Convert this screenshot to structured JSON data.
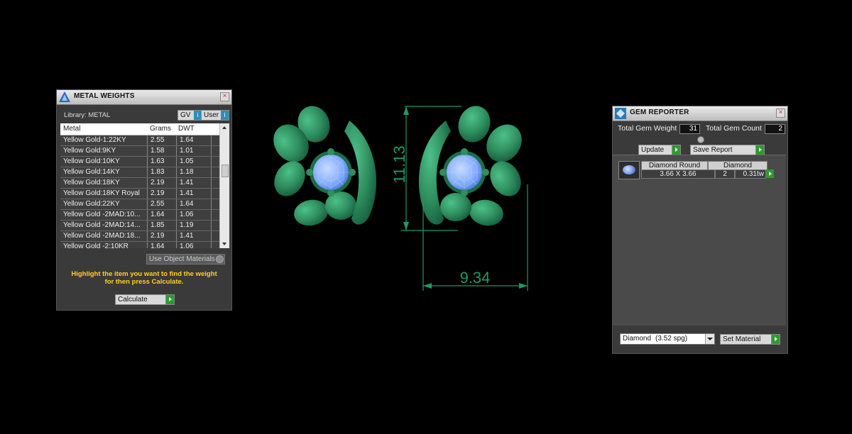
{
  "metal_weights": {
    "title": "METAL WEIGHTS",
    "library_label": "Library: METAL",
    "gv_label": "GV",
    "user_label": "User",
    "columns": [
      "Metal",
      "Grams",
      "DWT"
    ],
    "rows": [
      [
        "Yellow Gold-1:22KY",
        "2.55",
        "1.64"
      ],
      [
        "Yellow Gold:9KY",
        "1.58",
        "1.01"
      ],
      [
        "Yellow Gold:10KY",
        "1.63",
        "1.05"
      ],
      [
        "Yellow Gold:14KY",
        "1.83",
        "1.18"
      ],
      [
        "Yellow Gold:18KY",
        "2.19",
        "1.41"
      ],
      [
        "Yellow Gold:18KY Royal",
        "2.19",
        "1.41"
      ],
      [
        "Yellow Gold:22KY",
        "2.55",
        "1.64"
      ],
      [
        "Yellow Gold -2MAD:10...",
        "1.64",
        "1.06"
      ],
      [
        "Yellow Gold -2MAD:14...",
        "1.85",
        "1.19"
      ],
      [
        "Yellow Gold -2MAD:18...",
        "2.19",
        "1.41"
      ],
      [
        "Yellow Gold -2:10KR",
        "1.64",
        "1.06"
      ]
    ],
    "use_object_materials": "Use Object Materials",
    "hint_line1": "Highlight the item you want to find the weight",
    "hint_line2": "for then press Calculate.",
    "calculate_label": "Calculate"
  },
  "drawing": {
    "height_dim": "11.13",
    "width_dim": "9.34",
    "metal_color": "#2f8f5e",
    "gem_color": "#7fa9ff",
    "dim_color": "#1f9a62"
  },
  "gem_reporter": {
    "title": "GEM REPORTER",
    "total_weight_label": "Total Gem Weight",
    "total_weight_value": "31",
    "total_count_label": "Total Gem Count",
    "total_count_value": "2",
    "update_label": "Update",
    "save_report_label": "Save Report",
    "gem": {
      "shape": "Diamond Round",
      "size": "3.66 X 3.66",
      "material": "Diamond",
      "count": "2",
      "weight": "0.31tw"
    },
    "material_select": "Diamond",
    "material_spg": "(3.52 spg)",
    "set_material_label": "Set Material"
  },
  "colors": {
    "accent_green": "#2f9a2f",
    "hint_yellow": "#ffd21e"
  }
}
